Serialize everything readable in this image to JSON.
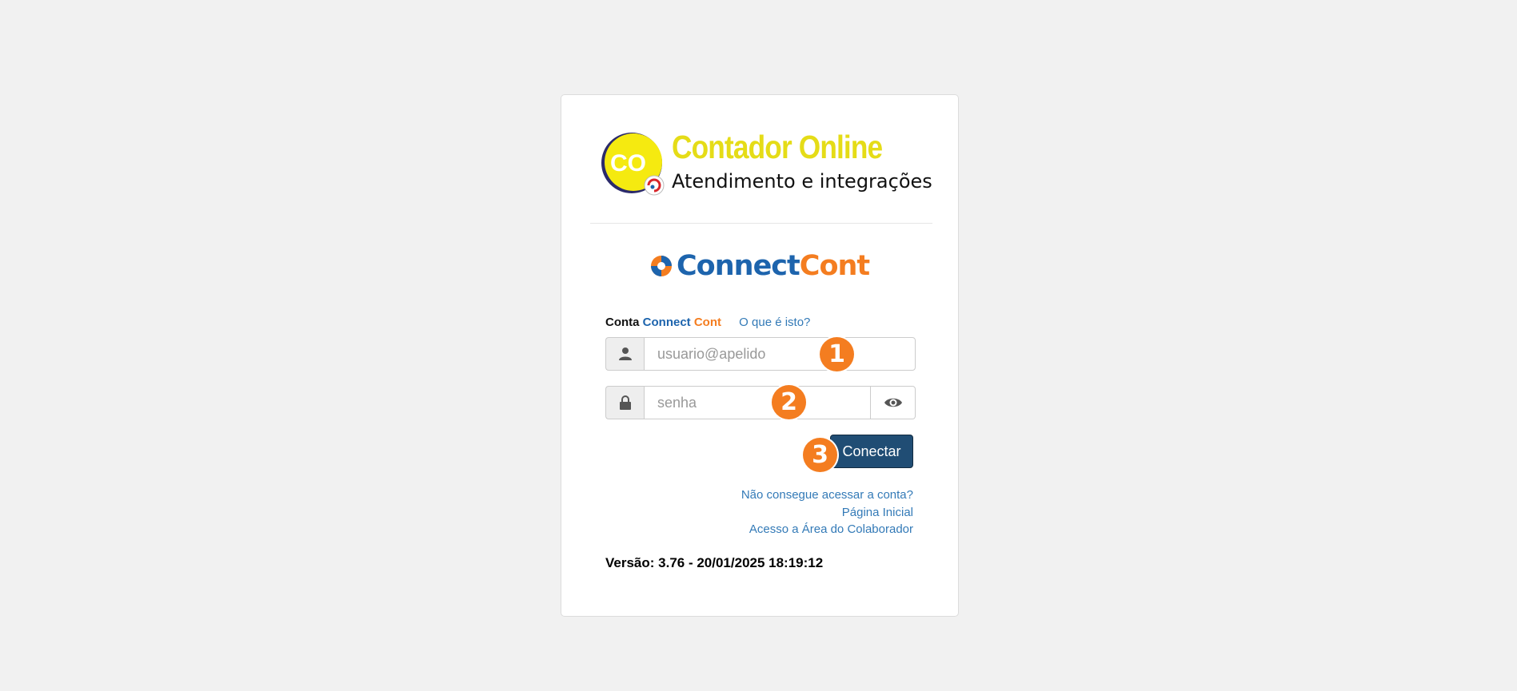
{
  "header": {
    "title": "Contador Online",
    "subtitle": "Atendimento e integrações",
    "logo_letters": "CO"
  },
  "brand": {
    "part1": "Connect",
    "part2": "Cont"
  },
  "form": {
    "account_label_1": "Conta",
    "account_label_2": "Connect",
    "account_label_3": "Cont",
    "what_is_link": "O que é isto?",
    "username_placeholder": "usuario@apelido",
    "password_placeholder": "senha",
    "submit_label": "Conectar"
  },
  "badges": [
    "1",
    "2",
    "3"
  ],
  "links": {
    "cannot_access": "Não consegue acessar a conta?",
    "home": "Página Inicial",
    "collaborator": "Acesso a Área do Colaborador"
  },
  "version": "Versão: 3.76 - 20/01/2025 18:19:12",
  "icons": {
    "user": "user-icon",
    "lock": "lock-icon",
    "eye": "eye-icon"
  },
  "colors": {
    "yellow": "#e5dc17",
    "brand_blue": "#1d64ad",
    "brand_orange": "#f47d20",
    "button": "#204d74",
    "link": "#337ab7"
  }
}
